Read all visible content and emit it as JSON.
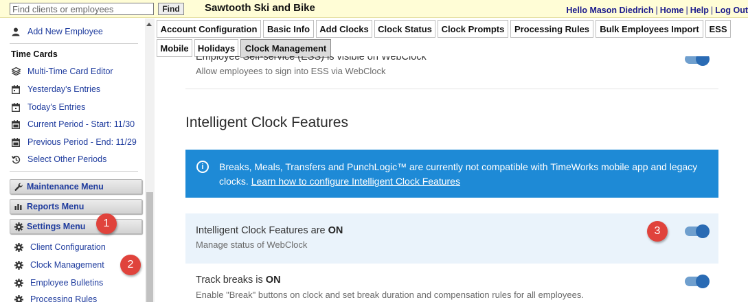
{
  "topbar": {
    "search_placeholder": "Find clients or employees",
    "find_label": "Find",
    "company": "Sawtooth Ski and Bike",
    "greeting": "Hello Mason Diedrich",
    "home": "Home",
    "help": "Help",
    "logout": "Log Out",
    "separator": "|"
  },
  "sidebar": {
    "add_employee": "Add New Employee",
    "timecards_heading": "Time Cards",
    "items": [
      {
        "label": "Multi-Time Card Editor",
        "icon": "layers-icon"
      },
      {
        "label": "Yesterday's Entries",
        "icon": "calendar-icon"
      },
      {
        "label": "Today's Entries",
        "icon": "calendar-icon"
      },
      {
        "label": "Current Period - Start: 11/30",
        "icon": "calendar-icon"
      },
      {
        "label": "Previous Period - End: 11/29",
        "icon": "calendar-icon"
      },
      {
        "label": "Select Other Periods",
        "icon": "history-icon"
      }
    ],
    "menus": [
      {
        "label": "Maintenance Menu",
        "icon": "wrench-icon"
      },
      {
        "label": "Reports Menu",
        "icon": "bar-chart-icon"
      },
      {
        "label": "Settings Menu",
        "icon": "gear-icon"
      }
    ],
    "settings_items": [
      {
        "label": "Client Configuration",
        "icon": "gear-icon"
      },
      {
        "label": "Clock Management",
        "icon": "gear-icon"
      },
      {
        "label": "Employee Bulletins",
        "icon": "gear-icon"
      },
      {
        "label": "Processing Rules",
        "icon": "gear-icon"
      }
    ]
  },
  "annotations": {
    "badge_1": "1",
    "badge_2": "2",
    "badge_3": "3",
    "color": "#e0433c"
  },
  "tabs": {
    "row1": [
      "Account Configuration",
      "Basic Info",
      "Add Clocks",
      "Clock Status",
      "Clock Prompts",
      "Processing Rules",
      "Bulk Employees Import",
      "ESS"
    ],
    "row2": [
      "Mobile",
      "Holidays",
      "Clock Management"
    ],
    "active": "Clock Management"
  },
  "main": {
    "ess_title": "Employee Self-service (ESS) is visible on WebClock",
    "ess_sub": "Allow employees to sign into ESS via WebClock",
    "section_title": "Intelligent Clock Features",
    "info_text": "Breaks, Meals, Transfers and PunchLogic™ are currently not compatible with TimeWorks mobile app and legacy clocks.",
    "info_link": "Learn how to configure Intelligent Clock Features",
    "icf_title_prefix": "Intelligent Clock Features are",
    "icf_state": "ON",
    "icf_sub": "Manage status of WebClock",
    "breaks_title_prefix": "Track breaks is",
    "breaks_state": "ON",
    "breaks_sub": "Enable \"Break\" buttons on clock and set break duration and compensation rules for all employees.",
    "toggle_color": "#2a6bb4",
    "info_color": "#1e8ad6"
  }
}
